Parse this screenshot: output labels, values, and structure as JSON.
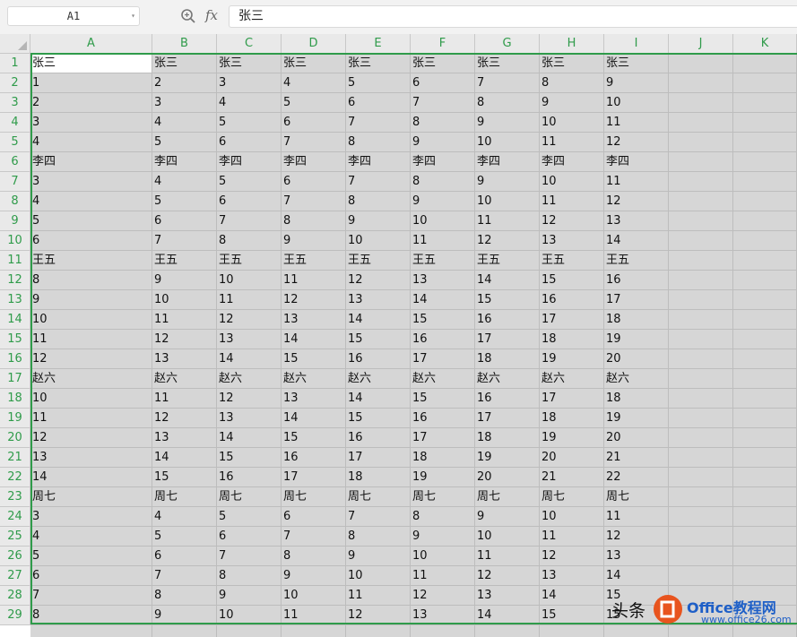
{
  "formula_bar": {
    "name_box": "A1",
    "name_box_arrow": "▾",
    "fx_label": "fx",
    "formula_value": "张三"
  },
  "columns": [
    "A",
    "B",
    "C",
    "D",
    "E",
    "F",
    "G",
    "H",
    "I",
    "J",
    "K"
  ],
  "rows": [
    "1",
    "2",
    "3",
    "4",
    "5",
    "6",
    "7",
    "8",
    "9",
    "10",
    "11",
    "12",
    "13",
    "14",
    "15",
    "16",
    "17",
    "18",
    "19",
    "20",
    "21",
    "22",
    "23",
    "24",
    "25",
    "26",
    "27",
    "28",
    "29"
  ],
  "cells": [
    [
      "张三",
      "张三",
      "张三",
      "张三",
      "张三",
      "张三",
      "张三",
      "张三",
      "张三"
    ],
    [
      "1",
      "2",
      "3",
      "4",
      "5",
      "6",
      "7",
      "8",
      "9"
    ],
    [
      "2",
      "3",
      "4",
      "5",
      "6",
      "7",
      "8",
      "9",
      "10"
    ],
    [
      "3",
      "4",
      "5",
      "6",
      "7",
      "8",
      "9",
      "10",
      "11"
    ],
    [
      "4",
      "5",
      "6",
      "7",
      "8",
      "9",
      "10",
      "11",
      "12"
    ],
    [
      "李四",
      "李四",
      "李四",
      "李四",
      "李四",
      "李四",
      "李四",
      "李四",
      "李四"
    ],
    [
      "3",
      "4",
      "5",
      "6",
      "7",
      "8",
      "9",
      "10",
      "11"
    ],
    [
      "4",
      "5",
      "6",
      "7",
      "8",
      "9",
      "10",
      "11",
      "12"
    ],
    [
      "5",
      "6",
      "7",
      "8",
      "9",
      "10",
      "11",
      "12",
      "13"
    ],
    [
      "6",
      "7",
      "8",
      "9",
      "10",
      "11",
      "12",
      "13",
      "14"
    ],
    [
      "王五",
      "王五",
      "王五",
      "王五",
      "王五",
      "王五",
      "王五",
      "王五",
      "王五"
    ],
    [
      "8",
      "9",
      "10",
      "11",
      "12",
      "13",
      "14",
      "15",
      "16"
    ],
    [
      "9",
      "10",
      "11",
      "12",
      "13",
      "14",
      "15",
      "16",
      "17"
    ],
    [
      "10",
      "11",
      "12",
      "13",
      "14",
      "15",
      "16",
      "17",
      "18"
    ],
    [
      "11",
      "12",
      "13",
      "14",
      "15",
      "16",
      "17",
      "18",
      "19"
    ],
    [
      "12",
      "13",
      "14",
      "15",
      "16",
      "17",
      "18",
      "19",
      "20"
    ],
    [
      "赵六",
      "赵六",
      "赵六",
      "赵六",
      "赵六",
      "赵六",
      "赵六",
      "赵六",
      "赵六"
    ],
    [
      "10",
      "11",
      "12",
      "13",
      "14",
      "15",
      "16",
      "17",
      "18"
    ],
    [
      "11",
      "12",
      "13",
      "14",
      "15",
      "16",
      "17",
      "18",
      "19"
    ],
    [
      "12",
      "13",
      "14",
      "15",
      "16",
      "17",
      "18",
      "19",
      "20"
    ],
    [
      "13",
      "14",
      "15",
      "16",
      "17",
      "18",
      "19",
      "20",
      "21"
    ],
    [
      "14",
      "15",
      "16",
      "17",
      "18",
      "19",
      "20",
      "21",
      "22"
    ],
    [
      "周七",
      "周七",
      "周七",
      "周七",
      "周七",
      "周七",
      "周七",
      "周七",
      "周七"
    ],
    [
      "3",
      "4",
      "5",
      "6",
      "7",
      "8",
      "9",
      "10",
      "11"
    ],
    [
      "4",
      "5",
      "6",
      "7",
      "8",
      "9",
      "10",
      "11",
      "12"
    ],
    [
      "5",
      "6",
      "7",
      "8",
      "9",
      "10",
      "11",
      "12",
      "13"
    ],
    [
      "6",
      "7",
      "8",
      "9",
      "10",
      "11",
      "12",
      "13",
      "14"
    ],
    [
      "7",
      "8",
      "9",
      "10",
      "11",
      "12",
      "13",
      "14",
      "15"
    ],
    [
      "8",
      "9",
      "10",
      "11",
      "12",
      "13",
      "14",
      "15",
      "15"
    ]
  ],
  "active_cell": "A1",
  "colors": {
    "header_text": "#2f9b4a",
    "selection_border": "#2f9b4a",
    "selected_fill": "#d6d6d6",
    "active_cell_fill": "#ffffff"
  },
  "watermark": {
    "text_left": "头条",
    "text_brand": "Office教程网",
    "text_url": "www.office26.com"
  }
}
